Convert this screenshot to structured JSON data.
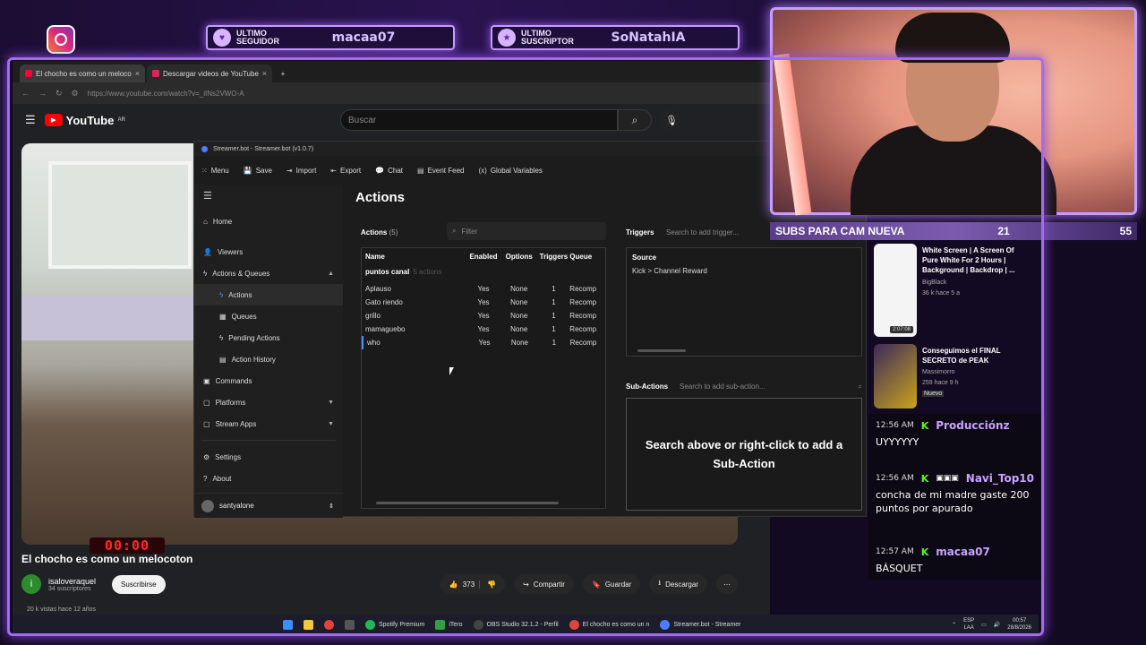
{
  "overlay": {
    "follower_caption": "ULTIMO SEGUIDOR",
    "follower_name": "macaa07",
    "sub_caption": "ULTIMO SUSCRIPTOR",
    "sub_name": "SoNatahIA",
    "goal_label": "SUBS PARA CAM NUEVA",
    "goal_current": "21",
    "goal_target": "55",
    "timer": "00:00",
    "accent_color": "#a36cf0"
  },
  "browser": {
    "tabs": [
      {
        "title": "El chocho es como un melocoto",
        "close": "×"
      },
      {
        "title": "Descargar videos de YouTube -",
        "close": "×"
      }
    ],
    "new_tab": "+",
    "url": "https://www.youtube.com/watch?v=_iINs2VWO-A"
  },
  "youtube": {
    "logo": "YouTube",
    "region": "AR",
    "search_placeholder": "Buscar",
    "video_title": "El chocho es como un melocoton",
    "channel_avatar_letter": "i",
    "channel_name": "isaloveraquel",
    "channel_subs": "34 suscriptores",
    "subscribe": "Suscribirse",
    "likes": "373",
    "share": "Compartir",
    "save": "Guardar",
    "download": "Descargar",
    "views": "20 k vistas  hace 12 años",
    "recommendations": [
      {
        "title": "White Screen | A Screen Of Pure White For 2 Hours | Background | Backdrop | ...",
        "channel": "BigBlack",
        "meta": "36 k  hace 5 a",
        "duration": "2:07:08"
      },
      {
        "title": "Conseguimos el FINAL SECRETO de PEAK",
        "channel": "Massimorro",
        "meta": "259  hace 9 h",
        "badge": "Nuevo"
      }
    ]
  },
  "streamerbot": {
    "title": "Streamer.bot - Streamer.bot (v1.0.7)",
    "menu": [
      "Menu",
      "Save",
      "Import",
      "Export",
      "Chat",
      "Event Feed",
      "Global Variables"
    ],
    "sidebar": [
      {
        "label": "Home"
      },
      {
        "label": "Viewers"
      },
      {
        "label": "Actions & Queues"
      },
      {
        "label": "Actions"
      },
      {
        "label": "Queues"
      },
      {
        "label": "Pending Actions"
      },
      {
        "label": "Action History"
      },
      {
        "label": "Commands"
      },
      {
        "label": "Platforms"
      },
      {
        "label": "Stream Apps"
      },
      {
        "label": "Settings"
      },
      {
        "label": "About"
      }
    ],
    "user": "santyalone",
    "heading": "Actions",
    "actions_label": "Actions",
    "actions_count": "(5)",
    "filter_placeholder": "Filter",
    "columns": [
      "Name",
      "Enabled",
      "Options",
      "Triggers",
      "Queue"
    ],
    "group": "puntos canal",
    "group_count": "5 actions",
    "rows": [
      {
        "name": "Aplauso",
        "enabled": "Yes",
        "options": "None",
        "triggers": "1",
        "queue": "Recomp"
      },
      {
        "name": "Gato riendo",
        "enabled": "Yes",
        "options": "None",
        "triggers": "1",
        "queue": "Recomp"
      },
      {
        "name": "grillo",
        "enabled": "Yes",
        "options": "None",
        "triggers": "1",
        "queue": "Recomp"
      },
      {
        "name": "mamaguebo",
        "enabled": "Yes",
        "options": "None",
        "triggers": "1",
        "queue": "Recomp"
      },
      {
        "name": "who",
        "enabled": "Yes",
        "options": "None",
        "triggers": "1",
        "queue": "Recomp"
      }
    ],
    "triggers_label": "Triggers",
    "triggers_search": "Search to add trigger...",
    "trigger_source_header": "Source",
    "trigger_source": "Kick > Channel Reward",
    "subactions_label": "Sub-Actions",
    "subactions_search": "Search to add sub-action...",
    "subactions_empty": "Search above or right-click to add a Sub-Action"
  },
  "chat": [
    {
      "time": "12:56 AM",
      "user": "Producciónz",
      "text": "UYYYYYY"
    },
    {
      "time": "12:56 AM",
      "user": "Navi_Top10",
      "text": "concha de mi madre gaste 200 puntos por apurado"
    },
    {
      "time": "12:57 AM",
      "user": "macaa07",
      "text": "BÁSQUET"
    }
  ],
  "taskbar": {
    "items": [
      "Spotify Premium",
      "iTero",
      "OBS Studio 32.1.2 - Perfil",
      "El chocho es como un n",
      "Streamer.bot - Streamer"
    ],
    "lang": "ESP",
    "lang2": "LAA",
    "time": "00:57",
    "date": "28/8/2026"
  }
}
